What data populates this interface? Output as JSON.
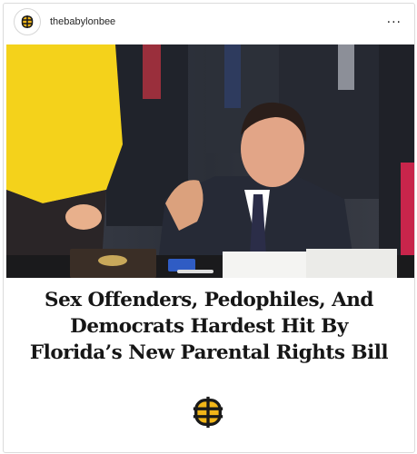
{
  "post": {
    "username": "thebabylonbee",
    "more_label": "...",
    "headline_lines": [
      "Sex Offenders, Pedophiles, And",
      "Democrats Hardest Hit By",
      "Florida’s New Parental Rights Bill"
    ]
  },
  "icons": {
    "avatar": "babylon-bee-logo-icon",
    "more": "more-options-icon",
    "brand": "babylon-bee-logo-icon"
  },
  "colors": {
    "brand_gold": "#f2b618",
    "brand_dark": "#1a1a1a",
    "border": "#dbdbdb"
  }
}
